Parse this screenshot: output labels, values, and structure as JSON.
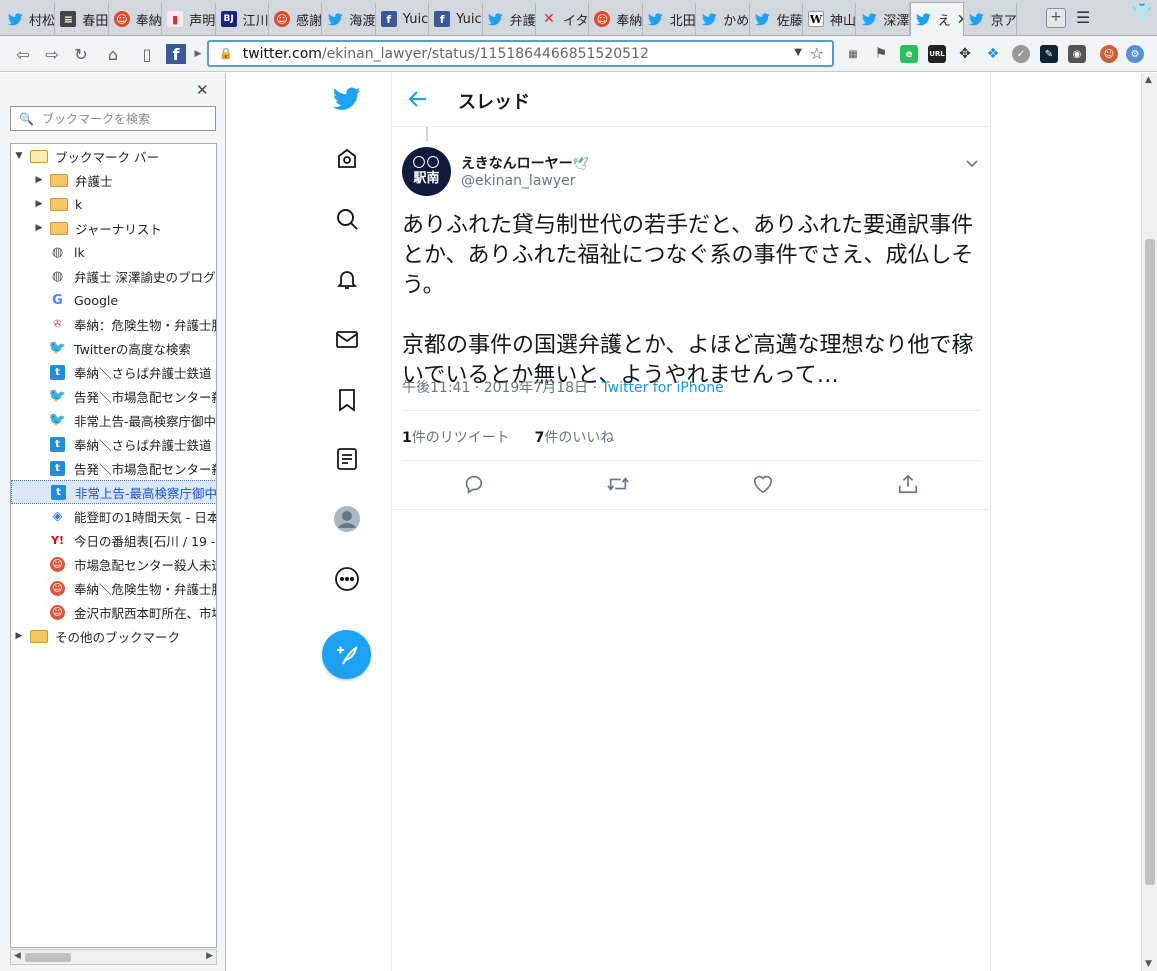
{
  "tabs": [
    {
      "title": "村松",
      "icon": "twitter-icon"
    },
    {
      "title": "春田",
      "icon": "book-icon"
    },
    {
      "title": "奉納",
      "icon": "red-face-icon"
    },
    {
      "title": "声明",
      "icon": "pink-doc-icon"
    },
    {
      "title": "江川",
      "icon": "bj-icon"
    },
    {
      "title": "感謝",
      "icon": "red-face-icon"
    },
    {
      "title": "海渡",
      "icon": "twitter-icon"
    },
    {
      "title": "Yuic",
      "icon": "facebook-icon"
    },
    {
      "title": "Yuic",
      "icon": "facebook-icon"
    },
    {
      "title": "弁護",
      "icon": "twitter-icon"
    },
    {
      "title": "イタ",
      "icon": "cross-icon"
    },
    {
      "title": "奉納",
      "icon": "red-face-icon"
    },
    {
      "title": "北田",
      "icon": "twitter-icon"
    },
    {
      "title": "かめ",
      "icon": "twitter-icon"
    },
    {
      "title": "佐藤",
      "icon": "twitter-icon"
    },
    {
      "title": "神山",
      "icon": "wikipedia-icon"
    },
    {
      "title": "深澤",
      "icon": "twitter-icon"
    },
    {
      "title": "え",
      "icon": "twitter-icon",
      "active": true
    },
    {
      "title": "京ア",
      "icon": "twitter-icon"
    }
  ],
  "url": {
    "host": "twitter.com",
    "path": "/ekinan_lawyer/status/1151864466851520512"
  },
  "sidebar": {
    "search_placeholder": "ブックマークを検索",
    "items": [
      {
        "label": "ブックマーク バー",
        "type": "folder-open",
        "level": 0
      },
      {
        "label": "弁護士",
        "type": "folder",
        "level": 1
      },
      {
        "label": "k",
        "type": "folder",
        "level": 1
      },
      {
        "label": "ジャーナリスト",
        "type": "folder",
        "level": 1
      },
      {
        "label": "lk",
        "type": "globe",
        "level": 1
      },
      {
        "label": "弁護士 深澤諭史のブログ",
        "type": "globe",
        "level": 1
      },
      {
        "label": "Google",
        "type": "google",
        "level": 1
      },
      {
        "label": "奉納：危険生物・弁護士脳",
        "type": "bird",
        "level": 1
      },
      {
        "label": "Twitterの高度な検索",
        "type": "twitter",
        "level": 1
      },
      {
        "label": "奉納＼さらば弁護士鉄道・",
        "type": "t",
        "level": 1
      },
      {
        "label": "告発＼市場急配センター殺",
        "type": "twitter",
        "level": 1
      },
      {
        "label": "非常上告-最高検察庁御中",
        "type": "twitter",
        "level": 1
      },
      {
        "label": "奉納＼さらば弁護士鉄道・",
        "type": "t",
        "level": 1
      },
      {
        "label": "告発＼市場急配センター殺",
        "type": "t",
        "level": 1
      },
      {
        "label": "非常上告-最高検察庁御中",
        "type": "t",
        "level": 1,
        "selected": true
      },
      {
        "label": "能登町の1時間天気 - 日本",
        "type": "cube",
        "level": 1
      },
      {
        "label": "今日の番組表[石川 / 19 -",
        "type": "yahoo",
        "level": 1
      },
      {
        "label": "市場急配センター殺人未遂",
        "type": "red",
        "level": 1
      },
      {
        "label": "奉納＼危険生物・弁護士脳",
        "type": "red",
        "level": 1
      },
      {
        "label": "金沢市駅西本町所在、市場",
        "type": "red",
        "level": 1
      },
      {
        "label": "その他のブックマーク",
        "type": "folder",
        "level": 0
      }
    ]
  },
  "thread": {
    "title": "スレッド"
  },
  "tweet": {
    "avatar_top": "〇〇",
    "avatar_bottom": "駅南",
    "display_name": "えきなんローヤー",
    "name_emoji": "🕊",
    "handle": "@ekinan_lawyer",
    "text": "ありふれた貸与制世代の若手だと、ありふれた要通訳事件とか、ありふれた福祉につなぐ系の事件でさえ、成仏しそう。\n\n京都の事件の国選弁護とか、よほど高邁な理想なり他で稼いでいるとか無いと、ようやれませんって…",
    "time": "午後11:41 · 2019年7月18日 · ",
    "source": "Twitter for iPhone",
    "retweet_count": "1",
    "retweet_label": "件のリツイート",
    "like_count": "7",
    "like_label": "件のいいね"
  },
  "colors": {
    "twitter_blue": "#1da1f2",
    "secondary_text": "#657786"
  }
}
